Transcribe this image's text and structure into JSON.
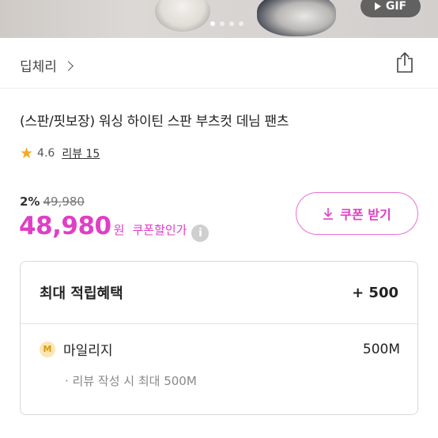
{
  "media": {
    "badge_label": "GIF",
    "slide_count": 4,
    "active_slide": 1
  },
  "store": {
    "name": "딥체리"
  },
  "product": {
    "title": "(스판/핏보장) 워싱 하이틴 스판 부츠컷 데님 팬츠",
    "rating": "4.6",
    "reviews_label": "리뷰 15",
    "discount_pct": "2%",
    "original_price": "49,980",
    "price": "48,980",
    "currency_unit": "원",
    "coupon_note": "쿠폰할인가",
    "info_glyph": "i"
  },
  "coupon_button": {
    "label": "쿠폰 받기"
  },
  "benefits": {
    "header_label": "최대 적립혜택",
    "header_amount": "+ 500",
    "mileage_badge": "M",
    "mileage_label": "마일리지",
    "mileage_amount": "500M",
    "mileage_note": "· 리뷰 작성 시 최대 500M"
  },
  "colors": {
    "accent": "#e03ec5",
    "star": "#f7a826",
    "border": "#d8d8d8"
  },
  "icons": [
    "star-icon",
    "chevron-right-icon",
    "share-icon",
    "download-icon",
    "info-icon",
    "mileage-icon",
    "play-icon"
  ]
}
